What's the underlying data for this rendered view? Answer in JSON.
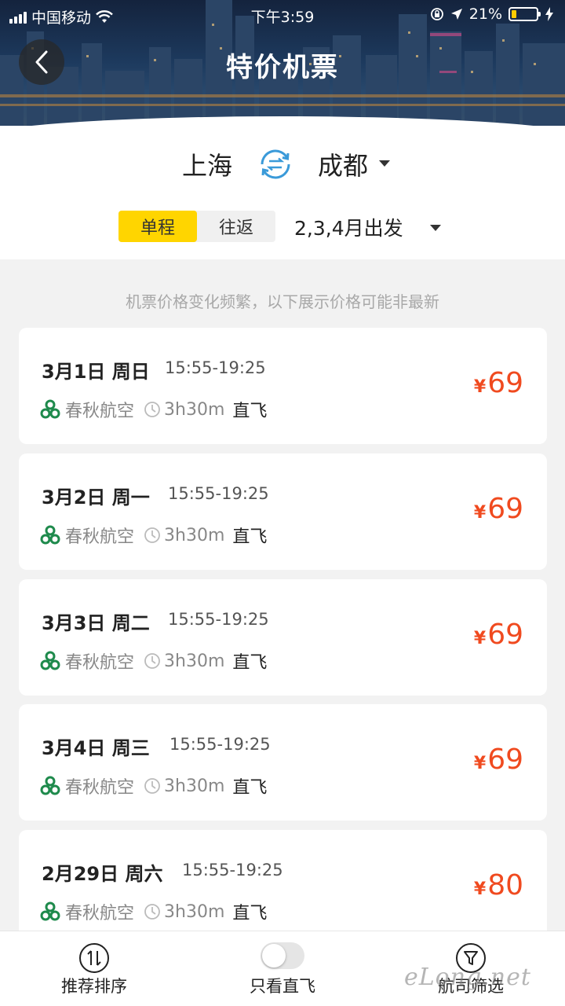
{
  "status_bar": {
    "carrier": "中国移动",
    "time": "下午3:59",
    "battery_percent": "21%",
    "battery_level": 0.21
  },
  "header": {
    "title": "特价机票"
  },
  "route": {
    "from": "上海",
    "to": "成都"
  },
  "trip_type": {
    "options": [
      "单程",
      "往返"
    ],
    "selected": "单程"
  },
  "date_range": "2,3,4月出发",
  "notice": "机票价格变化频繁，以下展示价格可能非最新",
  "flights": [
    {
      "date": "3月1日 周日",
      "time": "15:55-19:25",
      "airline": "春秋航空",
      "duration": "3h30m",
      "type": "直飞",
      "currency": "¥",
      "price": "69"
    },
    {
      "date": "3月2日 周一",
      "time": "15:55-19:25",
      "airline": "春秋航空",
      "duration": "3h30m",
      "type": "直飞",
      "currency": "¥",
      "price": "69"
    },
    {
      "date": "3月3日 周二",
      "time": "15:55-19:25",
      "airline": "春秋航空",
      "duration": "3h30m",
      "type": "直飞",
      "currency": "¥",
      "price": "69"
    },
    {
      "date": "3月4日 周三",
      "time": "15:55-19:25",
      "airline": "春秋航空",
      "duration": "3h30m",
      "type": "直飞",
      "currency": "¥",
      "price": "69"
    },
    {
      "date": "2月29日 周六",
      "time": "15:55-19:25",
      "airline": "春秋航空",
      "duration": "3h30m",
      "type": "直飞",
      "currency": "¥",
      "price": "80"
    }
  ],
  "bottom_bar": {
    "sort_label": "推荐排序",
    "direct_only_label": "只看直飞",
    "direct_only_on": false,
    "airline_filter_label": "航司筛选"
  },
  "watermark": "eLong.net",
  "colors": {
    "accent_yellow": "#ffd500",
    "price_red": "#f04a1f",
    "airline_green": "#1e8a4c",
    "swap_blue": "#3a9ad9"
  },
  "icons": [
    "back-arrow-icon",
    "swap-icon",
    "airline-logo-icon",
    "clock-icon",
    "sort-icon",
    "filter-icon"
  ]
}
